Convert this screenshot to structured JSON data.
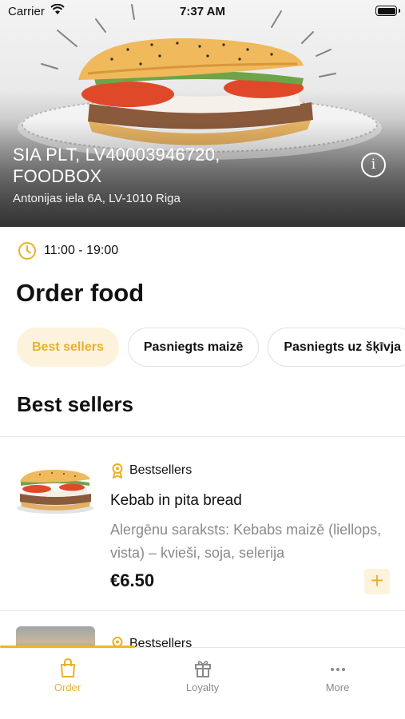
{
  "status_bar": {
    "carrier": "Carrier",
    "time": "7:37 AM"
  },
  "store": {
    "name": "SIA PLT, LV40003946720, FOODBOX",
    "address": "Antonijas iela 6A, LV-1010 Riga",
    "info_icon": "info-icon",
    "hours": "11:00 - 19:00"
  },
  "page": {
    "title": "Order food",
    "list_title": "Best sellers"
  },
  "categories": [
    {
      "label": "Best sellers",
      "active": true
    },
    {
      "label": "Pasniegts maizē",
      "active": false
    },
    {
      "label": "Pasniegts uz šķīvja",
      "active": false
    }
  ],
  "products": [
    {
      "badge": "Bestsellers",
      "name": "Kebab in pita bread",
      "description": "Alergēnu saraksts: Kebabs maizē (liellops, vista) – kvieši, soja, selerija",
      "price": "€6.50",
      "add_label": "+"
    },
    {
      "badge": "Bestsellers"
    }
  ],
  "tabbar": {
    "items": [
      {
        "label": "Order",
        "icon": "bag-icon",
        "active": true
      },
      {
        "label": "Loyalty",
        "icon": "gift-icon",
        "active": false
      },
      {
        "label": "More",
        "icon": "more-dots-icon",
        "active": false
      }
    ]
  },
  "colors": {
    "accent": "#e8b12c",
    "accent_light": "#fdf3dc",
    "muted_text": "#8a8a8a"
  }
}
